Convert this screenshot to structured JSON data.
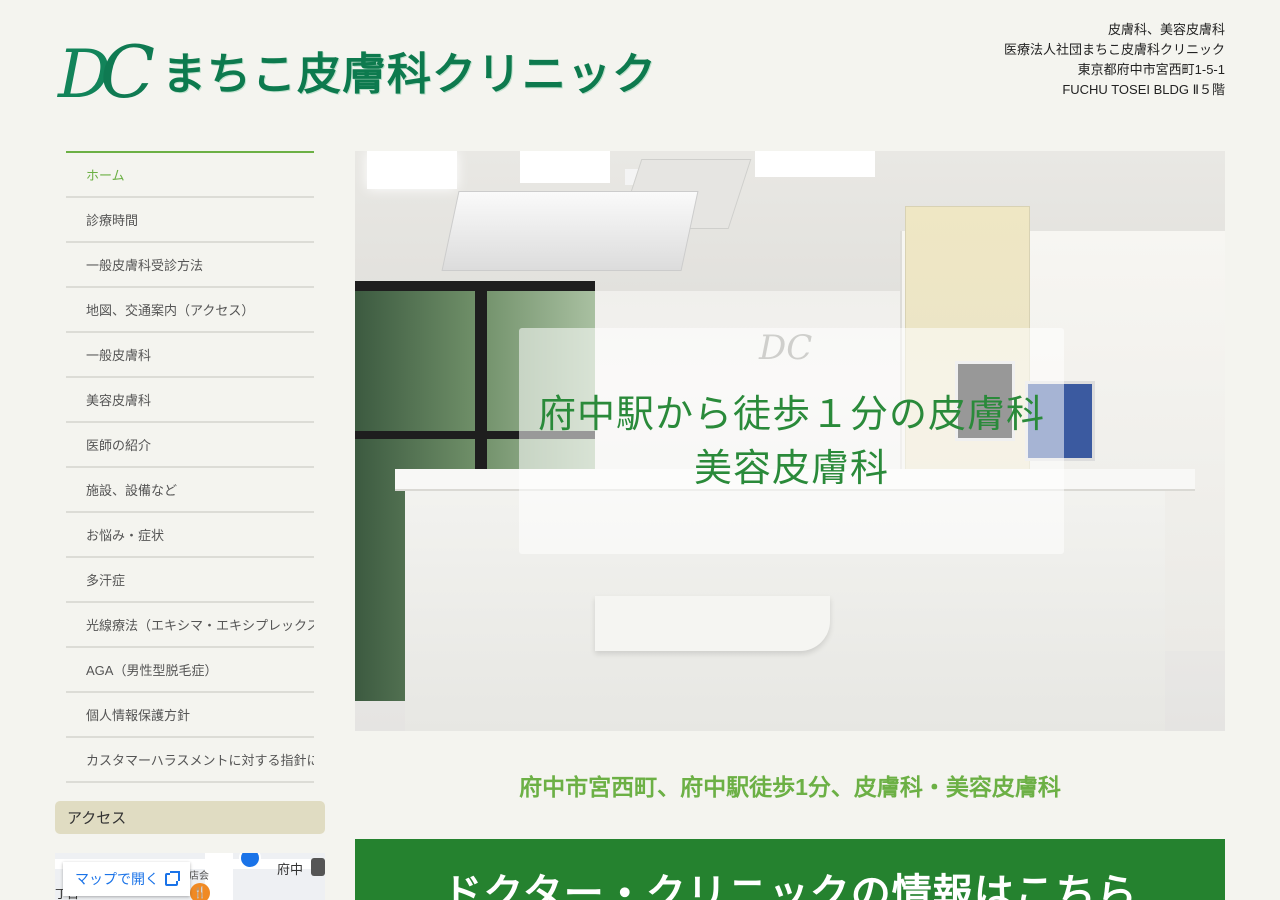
{
  "header": {
    "logo_text": "まちこ皮膚科クリニック",
    "logo_mark_d": "D",
    "logo_mark_c": "C",
    "info_lines": [
      "皮膚科、美容皮膚科",
      "医療法人社団まちこ皮膚科クリニック",
      "東京都府中市宮西町1-5-1",
      "FUCHU TOSEI BLDG Ⅱ５階"
    ]
  },
  "nav": {
    "items": [
      {
        "label": "ホーム",
        "active": true
      },
      {
        "label": "診療時間"
      },
      {
        "label": "一般皮膚科受診方法"
      },
      {
        "label": "地図、交通案内（アクセス）"
      },
      {
        "label": "一般皮膚科"
      },
      {
        "label": "美容皮膚科"
      },
      {
        "label": "医師の紹介"
      },
      {
        "label": "施設、設備など"
      },
      {
        "label": "お悩み・症状"
      },
      {
        "label": "多汗症"
      },
      {
        "label": "光線療法（エキシマ・エキシプレックス"
      },
      {
        "label": "AGA（男性型脱毛症）"
      },
      {
        "label": "個人情報保護方針"
      },
      {
        "label": "カスタマーハラスメントに対する指針に"
      }
    ],
    "active_color": "#6cb045"
  },
  "access": {
    "heading": "アクセス",
    "map_button": "マップで開く",
    "map_labels": {
      "station": "府中",
      "shop": "店会",
      "corner": "丁目"
    }
  },
  "hero": {
    "mini_logo": "DC",
    "line1": "府中駅から徒歩１分の皮膚科",
    "line2": "美容皮膚科"
  },
  "tagline": "府中市宮西町、府中駅徒歩1分、皮膚科・美容皮膚科",
  "banner": {
    "text": "ドクター・クリニックの情報はこちら",
    "color": "#25822f"
  }
}
